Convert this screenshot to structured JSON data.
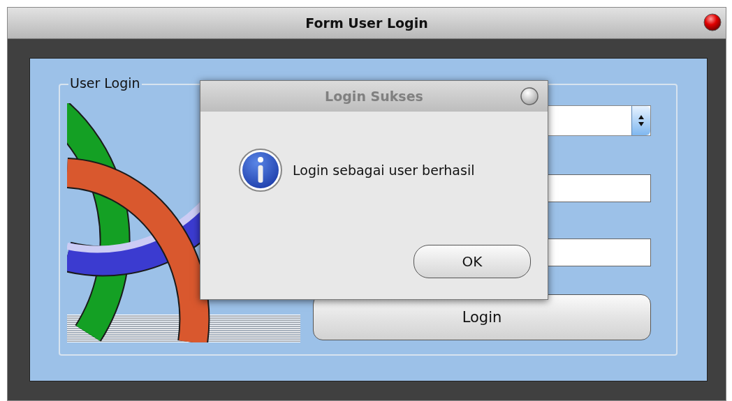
{
  "window": {
    "title": "Form User Login"
  },
  "group": {
    "legend": "User Login"
  },
  "form": {
    "fields": [
      {
        "kind": "combo"
      },
      {
        "kind": "text"
      },
      {
        "kind": "text"
      }
    ],
    "login_button": "Login"
  },
  "dialog": {
    "title": "Login Sukses",
    "message": "Login sebagai user berhasil",
    "ok_button": "OK"
  }
}
